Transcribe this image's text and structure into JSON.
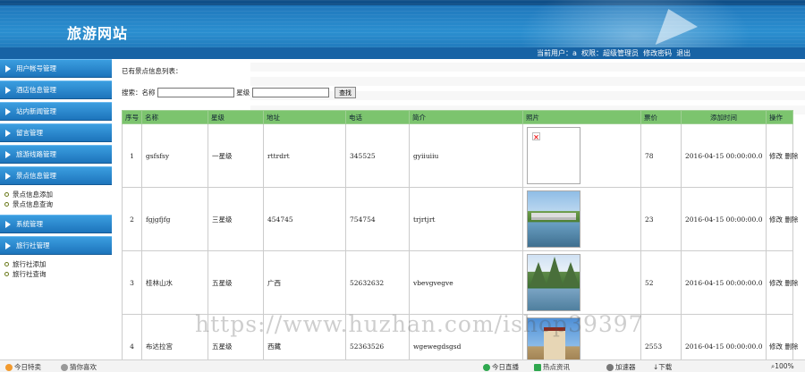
{
  "site": {
    "title": "旅游网站"
  },
  "userbar": {
    "current_user_label": "当前用户：",
    "user": "a",
    "role_label": "权限：",
    "role": "超级管理员",
    "change_password": "修改密码",
    "logout": "退出"
  },
  "sidebar": {
    "items": [
      {
        "label": "用户帐号管理"
      },
      {
        "label": "酒店信息管理"
      },
      {
        "label": "站内新闻管理"
      },
      {
        "label": "留言管理"
      },
      {
        "label": "旅游线路管理"
      },
      {
        "label": "景点信息管理",
        "children": [
          {
            "label": "景点信息添加"
          },
          {
            "label": "景点信息查询"
          }
        ]
      },
      {
        "label": "系统管理"
      },
      {
        "label": "旅行社管理",
        "children": [
          {
            "label": "旅行社添加"
          },
          {
            "label": "旅行社查询"
          }
        ]
      }
    ]
  },
  "main": {
    "section_label": "已有景点信息列表：",
    "search": {
      "label": "搜索：名称",
      "star_label": "星级",
      "button": "查找",
      "name_value": "",
      "star_value": ""
    },
    "columns": [
      "序号",
      "名称",
      "星级",
      "地址",
      "电话",
      "简介",
      "照片",
      "票价",
      "添加时间",
      "操作"
    ],
    "rows": [
      {
        "index": "1",
        "name": "gsfsfsy",
        "star": "一星级",
        "address": "rttrdrt",
        "phone": "345525",
        "intro": "gyiiuiiu",
        "photo": "broken",
        "price": "78",
        "added": "2016-04-15 00:00:00.0",
        "edit": "修改",
        "delete": "删除"
      },
      {
        "index": "2",
        "name": "fgjgfjfg",
        "star": "三星级",
        "address": "454745",
        "phone": "754754",
        "intro": "trjrtjrt",
        "photo": "bridge",
        "price": "23",
        "added": "2016-04-15 00:00:00.0",
        "edit": "修改",
        "delete": "删除"
      },
      {
        "index": "3",
        "name": "桂林山水",
        "star": "五星级",
        "address": "广西",
        "phone": "52632632",
        "intro": "vbevgvegve",
        "photo": "mountains",
        "price": "52",
        "added": "2016-04-15 00:00:00.0",
        "edit": "修改",
        "delete": "删除"
      },
      {
        "index": "4",
        "name": "布达拉宫",
        "star": "五星级",
        "address": "西藏",
        "phone": "52363526",
        "intro": "wgewegdsgsd",
        "photo": "palace",
        "price": "2553",
        "added": "2016-04-15 00:00:00.0",
        "edit": "修改",
        "delete": "删除"
      }
    ]
  },
  "watermark": "https://www.huzhan.com/ishop39397",
  "statusbar": {
    "left": [
      {
        "label": "今日特卖"
      },
      {
        "label": "猜你喜欢"
      }
    ],
    "right": [
      {
        "label": "今日直播"
      },
      {
        "label": "热点资讯"
      },
      {
        "label": "加速器"
      },
      {
        "label": "下载"
      },
      {
        "label": "100%"
      }
    ]
  },
  "colors": {
    "header_blue": "#1d73b8",
    "table_header_green": "#7cc46e",
    "menu_blue": "#2b8fd0"
  }
}
